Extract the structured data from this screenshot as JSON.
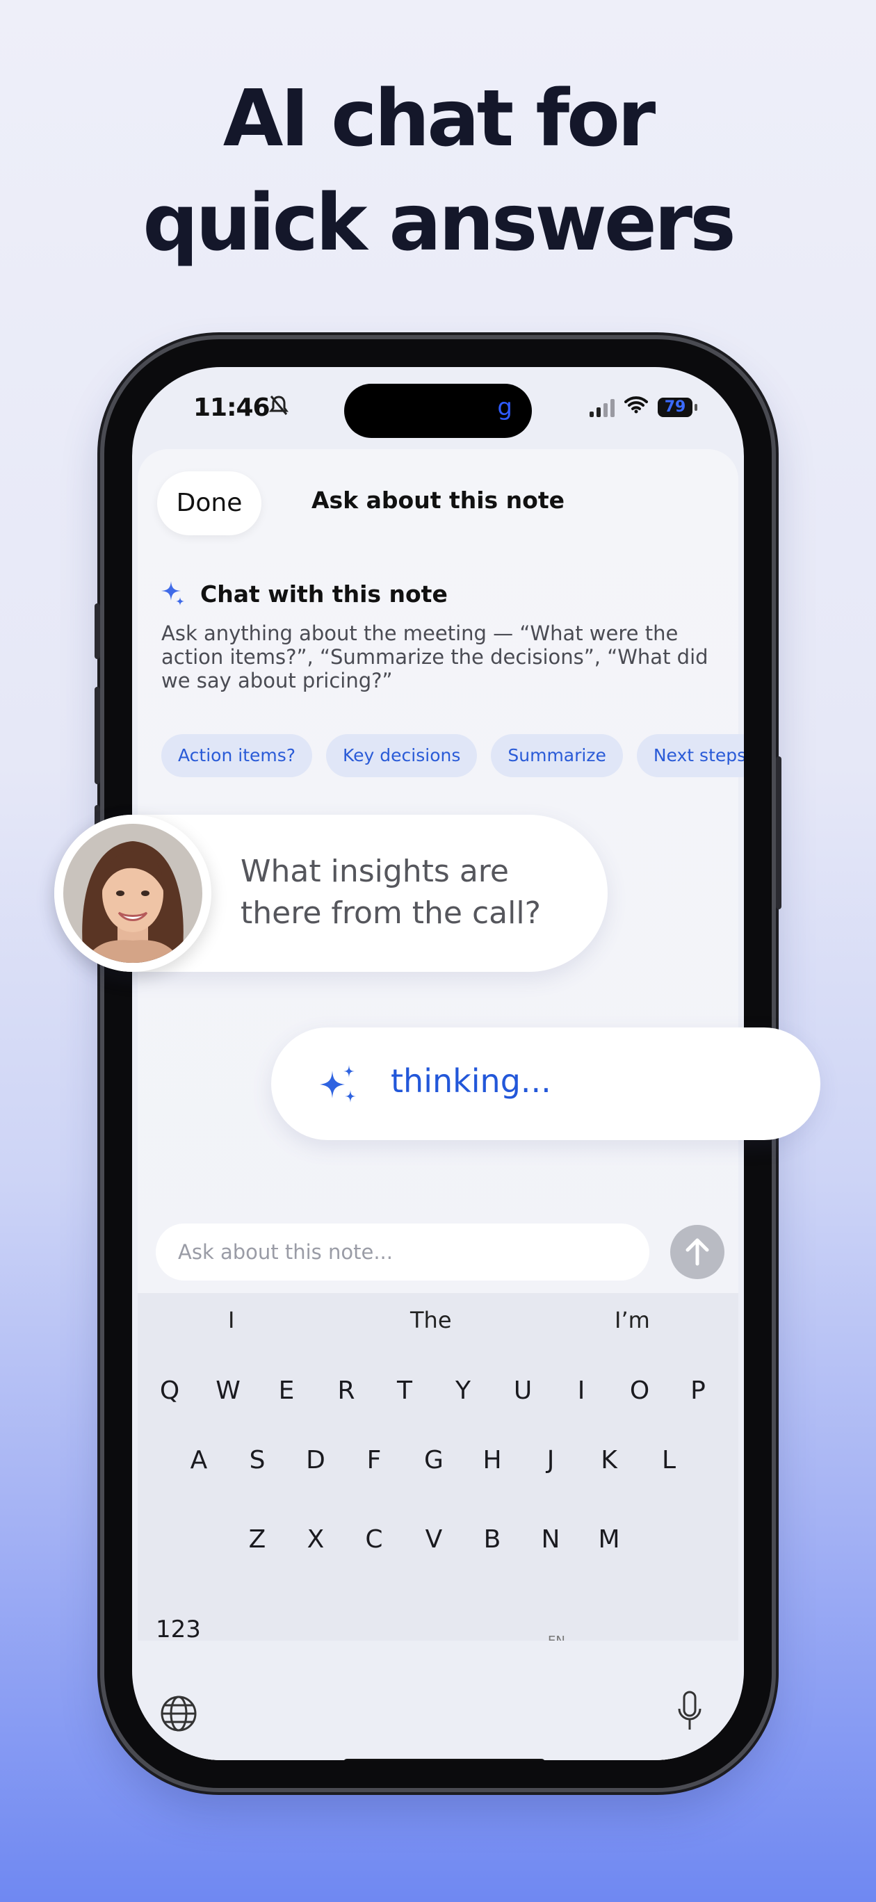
{
  "headline": {
    "line1": "AI chat for",
    "line2": "quick answers"
  },
  "status_bar": {
    "time": "11:46",
    "battery": "79"
  },
  "sheet": {
    "done_label": "Done",
    "title": "Ask about this note",
    "chat_title": "Chat with this note",
    "description": "Ask anything about the meeting — “What were the action items?”, “Summarize the decisions”, “What did we say about pricing?”",
    "chips": [
      "Action items?",
      "Key decisions",
      "Summarize",
      "Next steps"
    ]
  },
  "input": {
    "placeholder": "Ask about this note..."
  },
  "keyboard": {
    "suggestions": [
      "I",
      "The",
      "I’m"
    ],
    "row1": [
      "Q",
      "W",
      "E",
      "R",
      "T",
      "Y",
      "U",
      "I",
      "O",
      "P"
    ],
    "row2": [
      "A",
      "S",
      "D",
      "F",
      "G",
      "H",
      "J",
      "K",
      "L"
    ],
    "row3": [
      "Z",
      "X",
      "C",
      "V",
      "B",
      "N",
      "M"
    ],
    "numbers_key": "123",
    "language_label": "EN"
  },
  "user_message": {
    "line1": "What insights are",
    "line2": "there from the call?"
  },
  "assistant_status": "thinking..."
}
